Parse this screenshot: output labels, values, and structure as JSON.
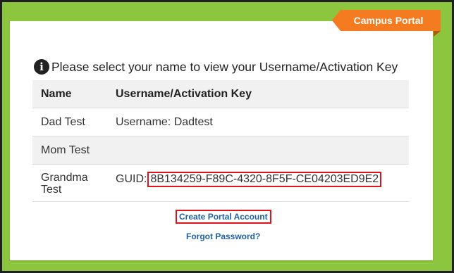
{
  "banner": {
    "label": "Campus Portal",
    "color": "#f47b20"
  },
  "info": {
    "icon": "info-icon",
    "icon_glyph": "i",
    "message": "Please select your name to view your Username/Activation Key"
  },
  "table": {
    "headers": [
      "Name",
      "Username/Activation Key"
    ],
    "rows": [
      {
        "name": "Dad Test",
        "key_label": "Username: Dadtest",
        "key_value": ""
      },
      {
        "name": "Mom Test",
        "key_label": "",
        "key_value": ""
      },
      {
        "name": "Grandma Test",
        "key_label": "GUID:",
        "key_value": "8B134259-F89C-4320-8F5F-CE04203ED9E2"
      }
    ]
  },
  "links": {
    "create_account": "Create Portal Account",
    "forgot_password": "Forgot Password?"
  },
  "colors": {
    "frame_green": "#8cc63e",
    "highlight_red": "#e0121b",
    "link_blue": "#1f5fa8"
  }
}
